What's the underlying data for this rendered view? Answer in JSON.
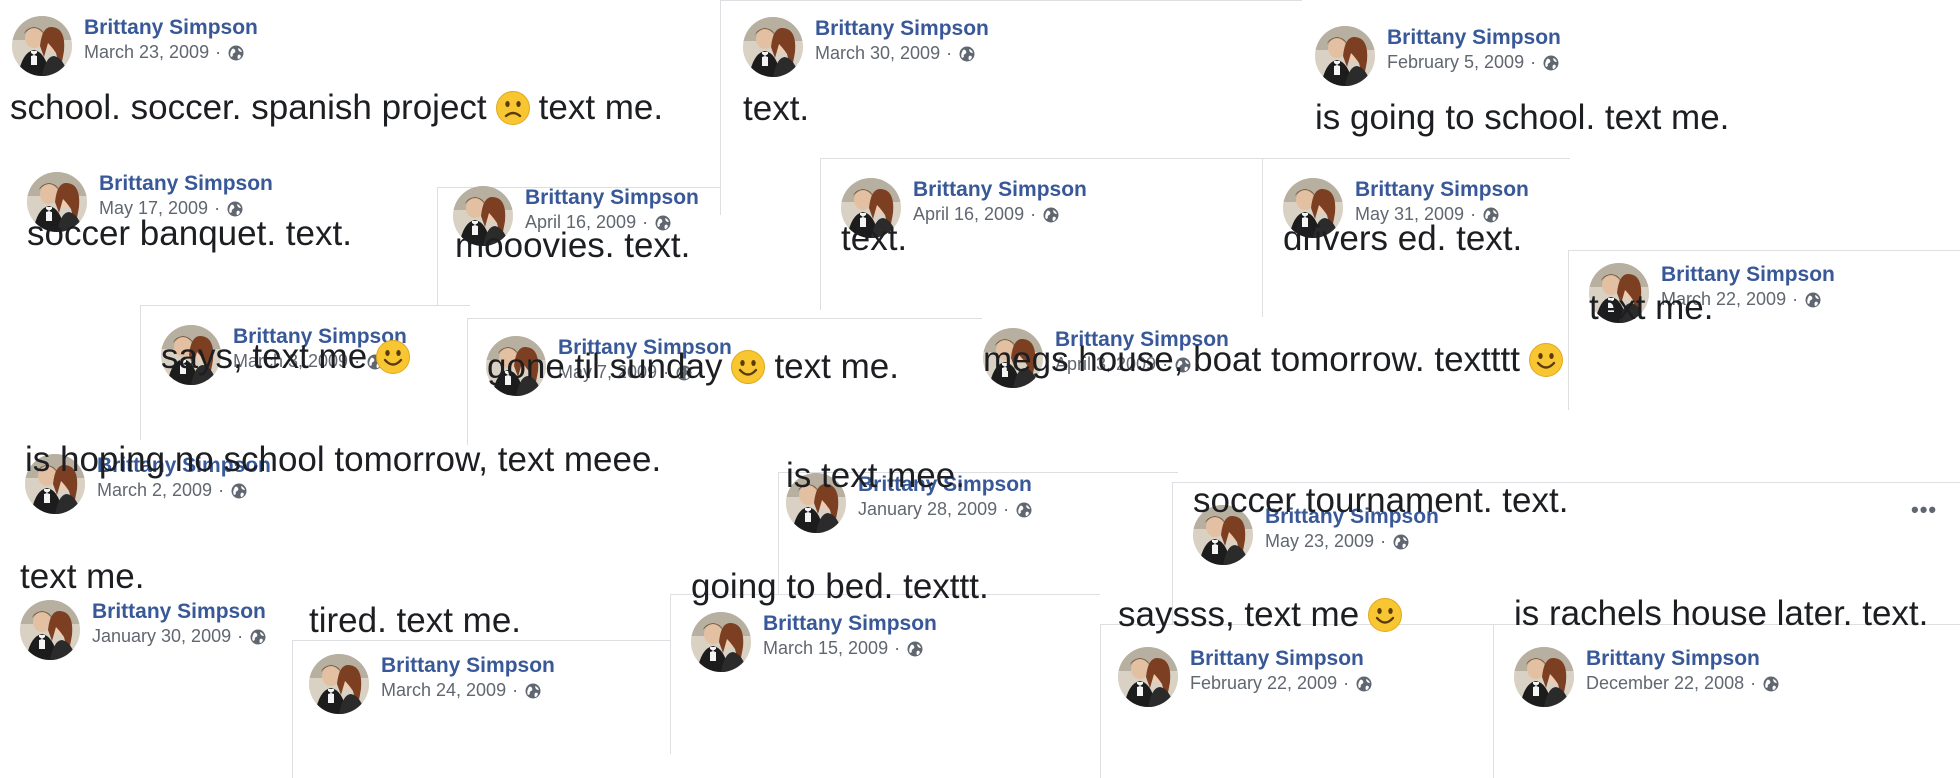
{
  "author": "Brittany Simpson",
  "separator": "·",
  "icons": {
    "privacy": "globe-icon",
    "more": "more-options-icon",
    "emoji_sad": "confused-face-emoji",
    "emoji_smile": "smiling-face-emoji"
  },
  "colors": {
    "name": "#385898",
    "meta": "#616770",
    "text": "#1c1e21",
    "emoji": "#f7c631"
  },
  "more_label": "•••",
  "posts": [
    {
      "id": 1,
      "date": "March 23, 2009",
      "pre": "school. soccer. spanish project",
      "emoji": "sad",
      "post": "text me."
    },
    {
      "id": 2,
      "date": "March 30, 2009",
      "pre": "text.",
      "emoji": "",
      "post": ""
    },
    {
      "id": 3,
      "date": "February 5, 2009",
      "pre": "is going to school. text me.",
      "emoji": "",
      "post": ""
    },
    {
      "id": 4,
      "date": "May 17, 2009",
      "pre": "soccer banquet. text.",
      "emoji": "",
      "post": ""
    },
    {
      "id": 5,
      "date": "April 16, 2009",
      "pre": "mooovies. text.",
      "emoji": "",
      "post": ""
    },
    {
      "id": 6,
      "date": "April 16, 2009",
      "pre": "text.",
      "emoji": "",
      "post": ""
    },
    {
      "id": 7,
      "date": "May 31, 2009",
      "pre": "drivers ed. text.",
      "emoji": "",
      "post": ""
    },
    {
      "id": 8,
      "date": "March 22, 2009",
      "pre": "text me.",
      "emoji": "",
      "post": ""
    },
    {
      "id": 9,
      "date": "March 3, 2009",
      "pre": "says, text me",
      "emoji": "smile",
      "post": ""
    },
    {
      "id": 10,
      "date": "May 7, 2009",
      "pre": "gone til sunday",
      "emoji": "smile",
      "post": "text me."
    },
    {
      "id": 11,
      "date": "April 3, 2009",
      "pre": "megs house, boat tomorrow. textttt",
      "emoji": "smile",
      "post": ""
    },
    {
      "id": 12,
      "date": "March 2, 2009",
      "pre": "is hoping no school tomorrow, text meee.",
      "emoji": "",
      "post": ""
    },
    {
      "id": 13,
      "date": "January 28, 2009",
      "pre": "is text mee.",
      "emoji": "",
      "post": ""
    },
    {
      "id": 14,
      "date": "May 23, 2009",
      "pre": "soccer tournament. text.",
      "emoji": "",
      "post": ""
    },
    {
      "id": 15,
      "date": "January 30, 2009",
      "pre": "text me.",
      "emoji": "",
      "post": ""
    },
    {
      "id": 16,
      "date": "March 24, 2009",
      "pre": "tired. text me.",
      "emoji": "",
      "post": ""
    },
    {
      "id": 17,
      "date": "March 15, 2009",
      "pre": "going to bed. texttt.",
      "emoji": "",
      "post": ""
    },
    {
      "id": 18,
      "date": "February 22, 2009",
      "pre": "saysss, text me",
      "emoji": "smile",
      "post": ""
    },
    {
      "id": 19,
      "date": "December 22, 2008",
      "pre": "is rachels house later. text.",
      "emoji": "",
      "post": ""
    }
  ]
}
